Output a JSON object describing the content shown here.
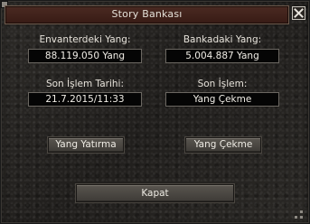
{
  "window": {
    "title": "Story Bankası"
  },
  "inventory": {
    "label": "Envanterdeki Yang:",
    "value": "88.119.050 Yang"
  },
  "bank": {
    "label": "Bankadaki Yang:",
    "value": "5.004.887 Yang"
  },
  "last_transaction_date": {
    "label": "Son İşlem Tarihi:",
    "value": "21.7.2015/11:33"
  },
  "last_transaction": {
    "label": "Son İşlem:",
    "value": "Yang Çekme"
  },
  "buttons": {
    "deposit": "Yang Yatırma",
    "withdraw": "Yang Çekme",
    "close": "Kapat"
  },
  "colors": {
    "title_bar": "#4a2a22",
    "background": "#262422",
    "field_background": "#050505",
    "text": "#e6e2da"
  },
  "icons": {
    "close": "close-icon",
    "resize": "resize-grip-icon"
  }
}
